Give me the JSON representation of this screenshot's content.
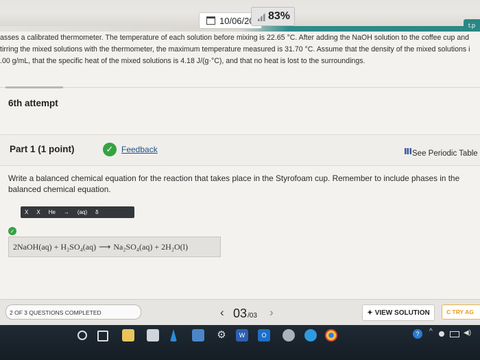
{
  "status": {
    "date": "10/06/20",
    "battery": "83%",
    "corner_button": "t.p"
  },
  "problem": {
    "line1": "asses a calibrated thermometer. The temperature of each solution before mixing is 22.65 °C. After adding the NaOH solution to the coffee cup and",
    "line2": "tirring the mixed solutions with the thermometer, the maximum temperature measured is 31.70 °C. Assume that the density of the mixed solutions i",
    "line3": ".00 g/mL, that the specific heat of the mixed solutions is 4.18 J/(g·°C), and that no heat is lost to the surroundings."
  },
  "attempt_label": "6th attempt",
  "part": {
    "title": "Part 1  (1 point)",
    "feedback_label": "Feedback",
    "periodic_table_label": "See Periodic Table"
  },
  "question_text": "Write a balanced chemical equation for the reaction that takes place in the Styrofoam cup. Remember to include phases in the balanced chemical equation.",
  "equation_toolbar": {
    "buttons": [
      "X",
      "X",
      "He",
      "→",
      "(aq)",
      "δ"
    ]
  },
  "answer": {
    "reactant1": "2NaOH(aq)",
    "plus1": "+",
    "reactant2": "H₂SO₄(aq)",
    "arrow": "⟶",
    "product1": "Na₂SO₄(aq)",
    "plus2": "+",
    "product2": "2H₂O(l)"
  },
  "footer": {
    "progress": "2 OF 3 QUESTIONS COMPLETED",
    "prev": "‹",
    "page_current": "03",
    "page_total": "/03",
    "next": "›",
    "view_solution": "VIEW SOLUTION",
    "try_again": "C TRY AG"
  },
  "taskbar": {
    "word_letter": "W",
    "outlook_letter": "O",
    "help": "?",
    "settings_glyph": "⚙"
  },
  "colors": {
    "accent_teal": "#2a8785",
    "check_green": "#36a341",
    "link_blue": "#1e4f8a",
    "try_again_orange": "#e59c1f"
  }
}
